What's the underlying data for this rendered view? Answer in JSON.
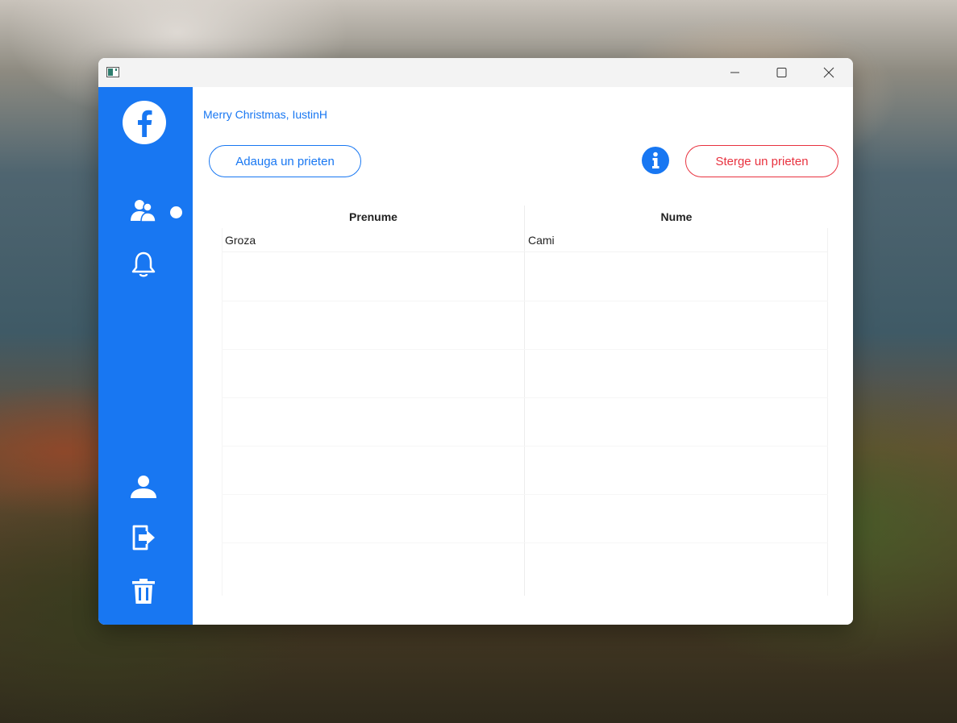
{
  "window": {
    "icons": {
      "app": "app-window-icon",
      "minimize": "minimize-icon",
      "maximize": "maximize-icon",
      "close": "close-icon"
    }
  },
  "sidebar": {
    "accent_color": "#1877f2",
    "logo": "facebook-logo",
    "items": [
      {
        "id": "friends",
        "icon": "friends-icon",
        "active": true
      },
      {
        "id": "notifications",
        "icon": "bell-icon",
        "active": false
      },
      {
        "id": "profile",
        "icon": "user-icon",
        "active": false
      },
      {
        "id": "logout",
        "icon": "logout-icon",
        "active": false
      },
      {
        "id": "delete-account",
        "icon": "trash-icon",
        "active": false
      }
    ]
  },
  "header": {
    "greeting": "Merry Christmas, IustinH"
  },
  "toolbar": {
    "add_friend_label": "Adauga un prieten",
    "remove_friend_label": "Sterge un prieten",
    "info_icon": "info-icon",
    "remove_color": "#e8323f"
  },
  "table": {
    "columns": [
      "Prenume",
      "Nume"
    ],
    "rows": [
      {
        "prenume": "Groza",
        "nume": "Cami"
      }
    ]
  }
}
